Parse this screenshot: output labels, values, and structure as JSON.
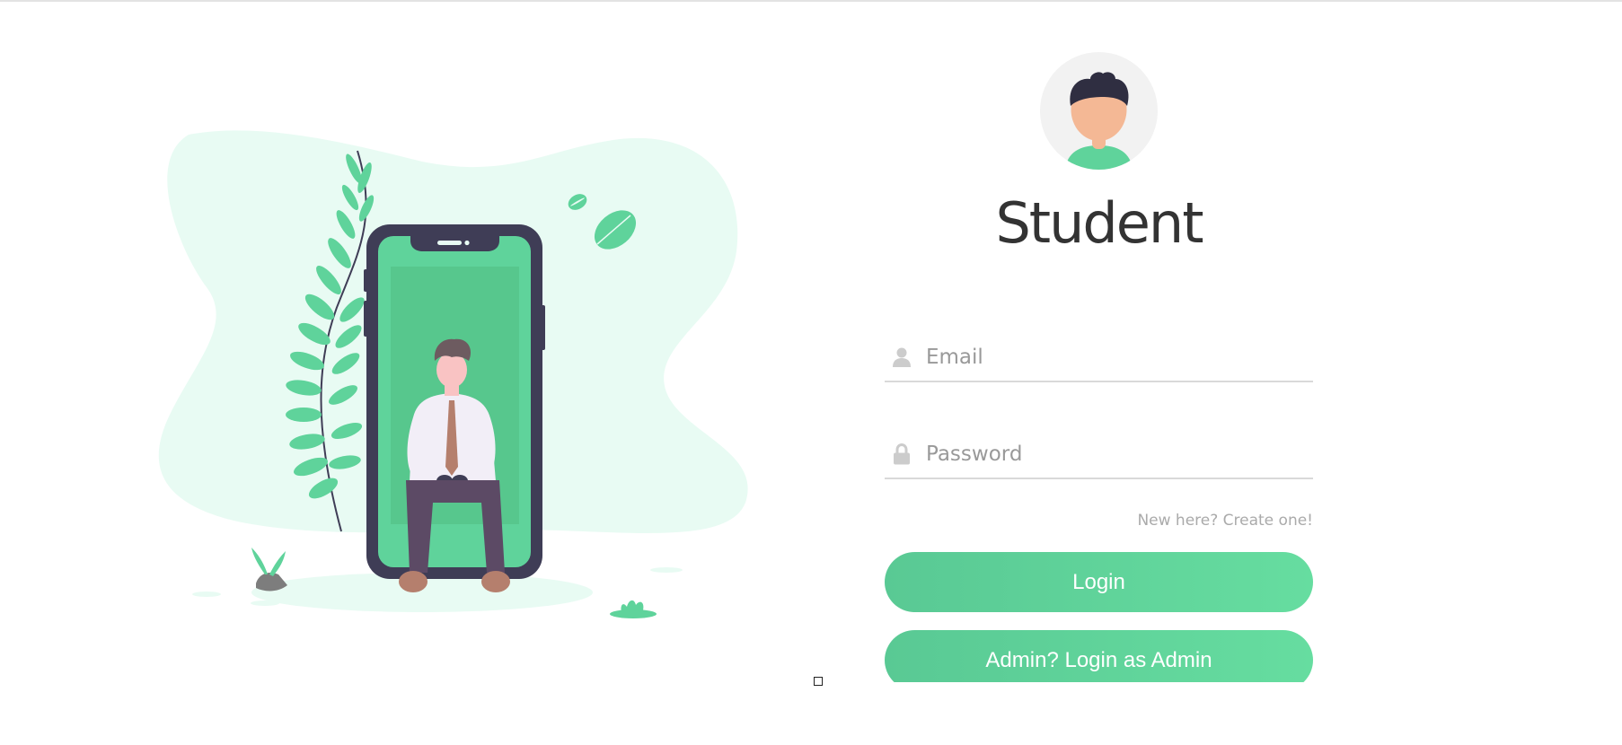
{
  "page": {
    "title": "Student"
  },
  "form": {
    "email_placeholder": "Email",
    "password_placeholder": "Password",
    "create_account_link": "New here? Create one!",
    "login_button": "Login",
    "admin_button": "Admin? Login as Admin"
  },
  "colors": {
    "accent": "#5fd39b",
    "accent_dark": "#3f3d56",
    "blob": "#e8fbf3",
    "title_text": "#333333",
    "muted_text": "#999999"
  },
  "icons": {
    "avatar": "student-avatar-icon",
    "email": "user-icon",
    "password": "lock-icon"
  }
}
